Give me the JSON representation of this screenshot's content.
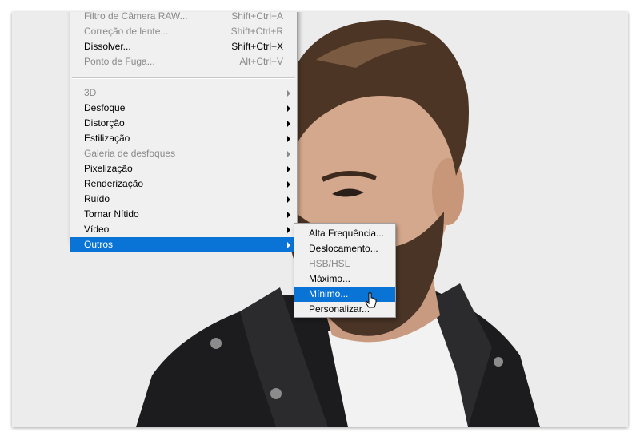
{
  "filter_menu": {
    "items": [
      {
        "label": "Filtro de Câmera RAW...",
        "shortcut": "Shift+Ctrl+A",
        "disabled": true
      },
      {
        "label": "Correção de lente...",
        "shortcut": "Shift+Ctrl+R",
        "disabled": true
      },
      {
        "label": "Dissolver...",
        "shortcut": "Shift+Ctrl+X",
        "disabled": false
      },
      {
        "label": "Ponto de Fuga...",
        "shortcut": "Alt+Ctrl+V",
        "disabled": true
      },
      {
        "label": "3D",
        "disabled": true
      },
      {
        "label": "Desfoque"
      },
      {
        "label": "Distorção"
      },
      {
        "label": "Estilização"
      },
      {
        "label": "Galeria de desfoques",
        "disabled": true
      },
      {
        "label": "Pixelização"
      },
      {
        "label": "Renderização"
      },
      {
        "label": "Ruído"
      },
      {
        "label": "Tornar Nítido"
      },
      {
        "label": "Vídeo"
      },
      {
        "label": "Outros",
        "highlighted": true
      }
    ]
  },
  "submenu_outros": {
    "items": [
      {
        "label": "Alta Frequência..."
      },
      {
        "label": "Deslocamento..."
      },
      {
        "label": "HSB/HSL",
        "disabled": true
      },
      {
        "label": "Máximo..."
      },
      {
        "label": "Mínimo...",
        "highlighted": true
      },
      {
        "label": "Personalizar..."
      }
    ]
  },
  "colors": {
    "menu_bg": "#f0f0f0",
    "highlight": "#0a74d6",
    "disabled_text": "#8a8a8a",
    "canvas_bg": "#ececec"
  }
}
